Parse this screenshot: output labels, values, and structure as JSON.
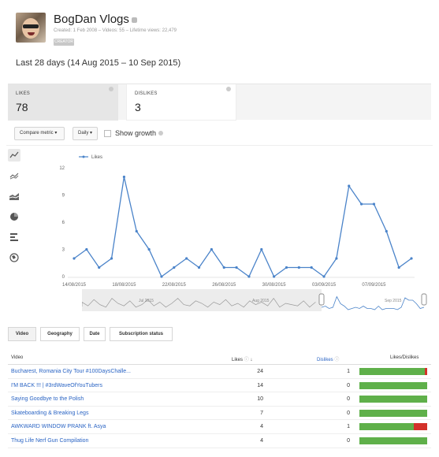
{
  "channel": {
    "name": "BogDan Vlogs",
    "meta": "Created: 1 Feb 2008 – Videos: 55 – Lifetime views: 22,479",
    "badge": "CREATOR"
  },
  "date_range": "Last 28 days (14 Aug 2015 – 10 Sep 2015)",
  "metrics": [
    {
      "label": "LIKES",
      "value": "78"
    },
    {
      "label": "DISLIKES",
      "value": "3"
    }
  ],
  "controls": {
    "compare_metric": "Compare metric",
    "interval": "Daily",
    "show_growth": "Show growth",
    "show_growth_checked": false
  },
  "chart_types": [
    "line-chart-icon",
    "multi-line-chart-icon",
    "stacked-area-chart-icon",
    "pie-chart-icon",
    "bar-chart-icon",
    "map-chart-icon"
  ],
  "chart_data": {
    "type": "line",
    "legend": "Likes",
    "series": [
      {
        "name": "Likes",
        "color": "#4a83c9",
        "values": [
          2,
          3,
          1,
          2,
          11,
          5,
          3,
          0,
          1,
          2,
          1,
          3,
          1,
          1,
          0,
          3,
          0,
          1,
          1,
          1,
          0,
          2,
          10,
          8,
          8,
          5,
          1,
          2
        ]
      }
    ],
    "x": [
      "14/08/2015",
      "15/08/2015",
      "16/08/2015",
      "17/08/2015",
      "18/08/2015",
      "19/08/2015",
      "20/08/2015",
      "21/08/2015",
      "22/08/2015",
      "23/08/2015",
      "24/08/2015",
      "25/08/2015",
      "26/08/2015",
      "27/08/2015",
      "28/08/2015",
      "29/08/2015",
      "30/08/2015",
      "31/08/2015",
      "01/09/2015",
      "02/09/2015",
      "03/09/2015",
      "04/09/2015",
      "05/09/2015",
      "06/09/2015",
      "07/09/2015",
      "08/09/2015",
      "09/09/2015",
      "10/09/2015"
    ],
    "x_tick_labels": [
      "14/08/2015",
      "18/08/2015",
      "22/08/2015",
      "26/08/2015",
      "30/08/2015",
      "03/09/2015",
      "07/09/2015"
    ],
    "y_ticks": [
      0,
      3,
      6,
      9,
      12
    ],
    "ylim": [
      0,
      12
    ],
    "grid": false,
    "legend_placement": "top-left"
  },
  "navigator": {
    "labels": [
      "Jul 2015",
      "Aug 2015",
      "Sep 2015"
    ]
  },
  "tabs": [
    "Video",
    "Geography",
    "Date",
    "Subscription status"
  ],
  "table": {
    "headers": {
      "video": "Video",
      "likes": "Likes",
      "dislikes": "Dislikes",
      "ratio": "Likes/Dislikes"
    },
    "rows": [
      {
        "title": "Bucharest, Romania City Tour #100DaysChalle...",
        "likes": "24",
        "dislikes": "1",
        "like_share": 0.96
      },
      {
        "title": "I'M BACK !!! | #3rdWaveOfYouTubers",
        "likes": "14",
        "dislikes": "0",
        "like_share": 1
      },
      {
        "title": "Saying Goodbye to the Polish",
        "likes": "10",
        "dislikes": "0",
        "like_share": 1
      },
      {
        "title": "Skateboarding & Breaking Legs",
        "likes": "7",
        "dislikes": "0",
        "like_share": 1
      },
      {
        "title": "AWKWARD WINDOW PRANK ft. Asya",
        "likes": "4",
        "dislikes": "1",
        "like_share": 0.8
      },
      {
        "title": "Thug Life Nerf Gun Compilation",
        "likes": "4",
        "dislikes": "0",
        "like_share": 1
      }
    ]
  }
}
